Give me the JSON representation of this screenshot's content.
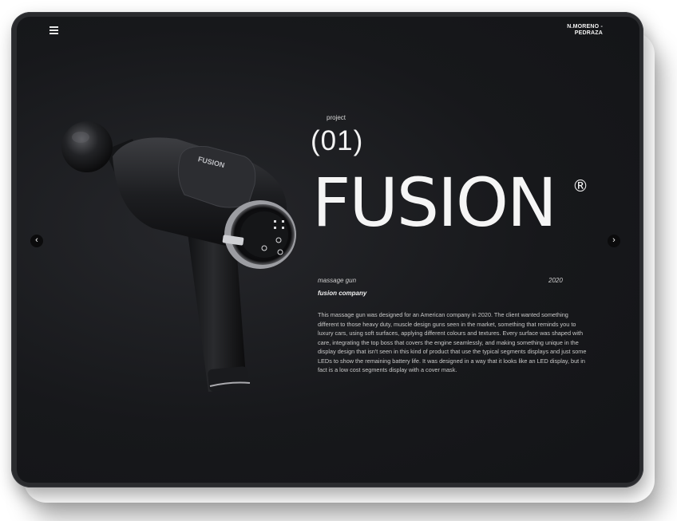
{
  "header": {
    "menu_icon": "hamburger-icon",
    "logo_line1": "N.MORENO -",
    "logo_line2": "PEDRAZA"
  },
  "navigation": {
    "prev_icon": "chevron-left-icon",
    "prev_glyph": "‹",
    "next_icon": "chevron-right-icon",
    "next_glyph": "›"
  },
  "project": {
    "label": "project",
    "number": "(01)",
    "title": "FUSION",
    "registered_mark": "®",
    "type": "massage gun",
    "year": "2020",
    "client": "fusion company",
    "description": "This massage gun was designed for an American company in 2020. The client wanted something different to those heavy duty, muscle design guns seen in the market, something that reminds you to luxury cars, using soft surfaces, applying different colours and textures. Every surface was shaped with care, integrating the top boss that covers the engine seamlessly, and making something unique in the display design that isn't seen in this kind of product that use the typical segments displays and just some LEDs to show the remaining battery life. It was designed in a way that it looks like an LED display, but in fact is a low cost segments display with a cover mask.",
    "product_brand_text": "FUSION"
  },
  "colors": {
    "screen_bg": "#17181b",
    "frame": "#2a2b2e",
    "text_primary": "#f5f5f5",
    "text_secondary": "#c9c9c9"
  }
}
